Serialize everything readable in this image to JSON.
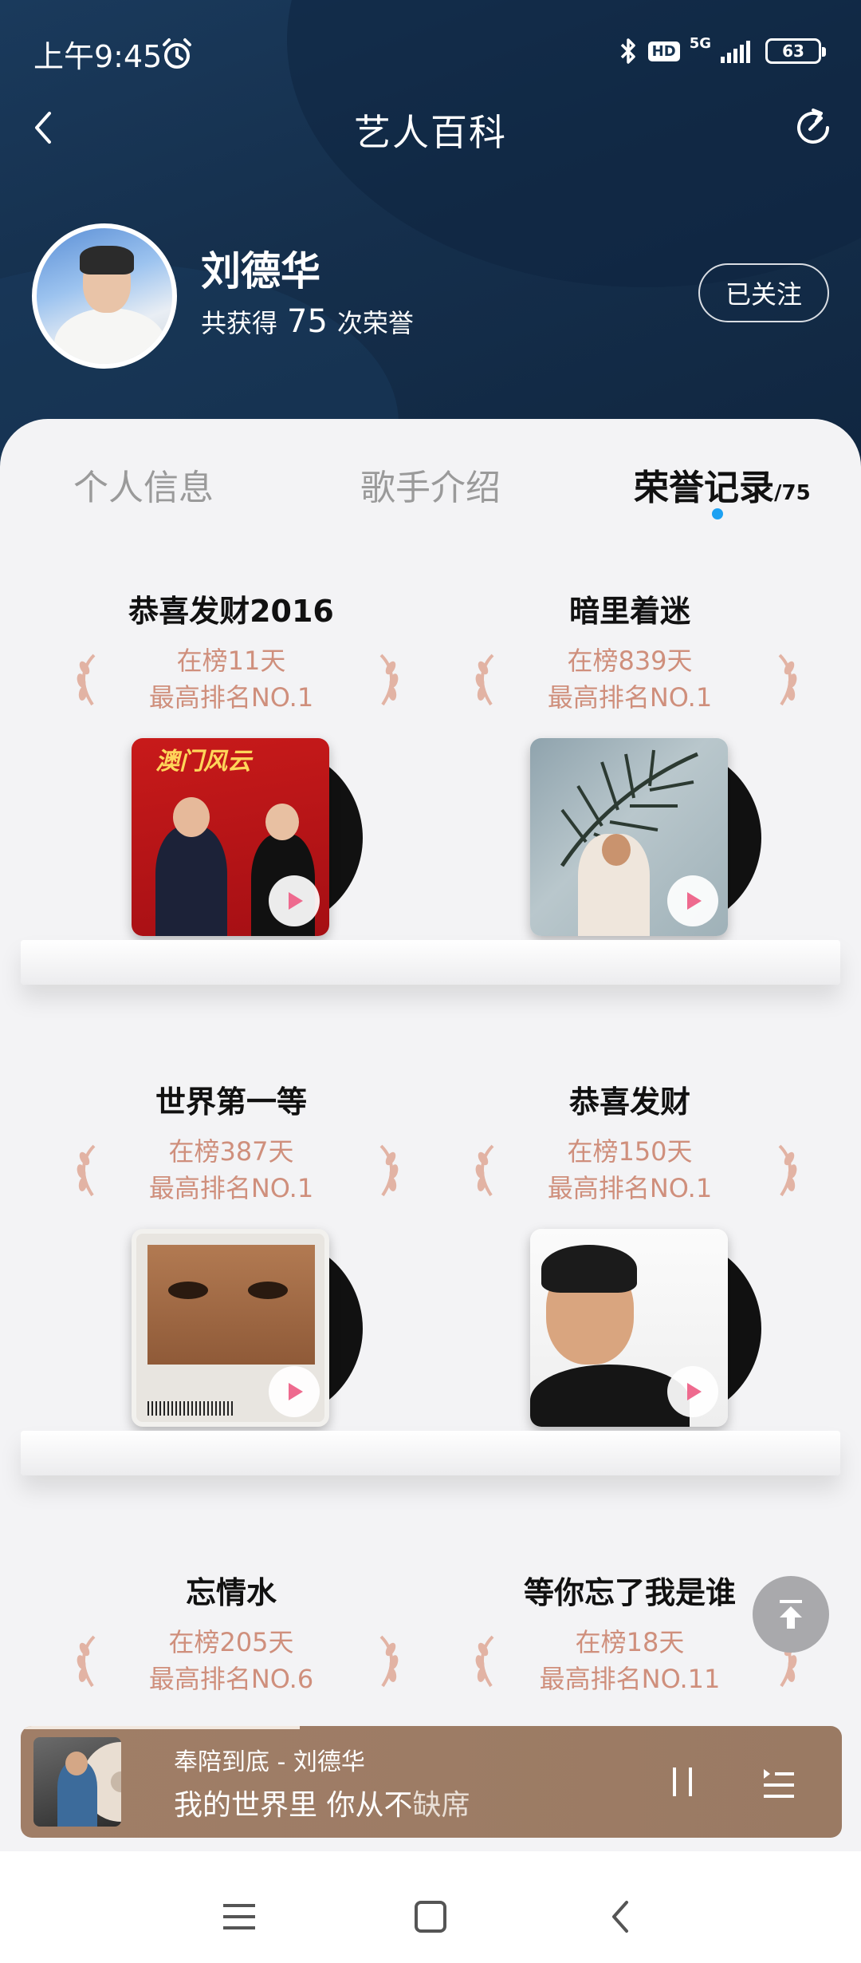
{
  "status_bar": {
    "time": "上午9:45",
    "hd": "HD",
    "network": "5G",
    "battery": "63"
  },
  "nav": {
    "title": "艺人百科"
  },
  "profile": {
    "name": "刘德华",
    "honor_prefix": "共获得",
    "honor_count": "75",
    "honor_suffix": "次荣誉",
    "follow_label": "已关注"
  },
  "tabs": [
    {
      "label": "个人信息",
      "active": false
    },
    {
      "label": "歌手介绍",
      "active": false
    },
    {
      "label": "荣誉记录",
      "count": "/75",
      "active": true
    }
  ],
  "songs": [
    {
      "title": "恭喜发财2016",
      "days": "在榜11天",
      "rank": "最高排名NO.1",
      "cover": "cover-red"
    },
    {
      "title": "暗里着迷",
      "days": "在榜839天",
      "rank": "最高排名NO.1",
      "cover": "cover-palm"
    },
    {
      "title": "世界第一等",
      "days": "在榜387天",
      "rank": "最高排名NO.1",
      "cover": "cover-eyes"
    },
    {
      "title": "恭喜发财",
      "days": "在榜150天",
      "rank": "最高排名NO.1",
      "cover": "cover-portrait"
    },
    {
      "title": "忘情水",
      "days": "在榜205天",
      "rank": "最高排名NO.6",
      "cover": ""
    },
    {
      "title": "等你忘了我是谁",
      "days": "在榜18天",
      "rank": "最高排名NO.11",
      "cover": ""
    }
  ],
  "player": {
    "song": "奉陪到底  -  刘德华",
    "lyric_main": "我的世界里 你从不",
    "lyric_dim": "缺席",
    "progress": 0.34
  },
  "colors": {
    "accent": "#1da1f2",
    "stat_text": "#cf8f7c",
    "header_bg": "#153250",
    "player_bg": "#a07e67"
  },
  "icons": {
    "back": "back-icon",
    "share": "share-icon",
    "play": "play-icon",
    "laurel": "laurel-icon",
    "pause": "pause-icon",
    "playlist": "playlist-icon",
    "back_top": "back-to-top-icon",
    "menu": "menu-icon",
    "home": "home-icon",
    "sys_back": "system-back-icon"
  }
}
